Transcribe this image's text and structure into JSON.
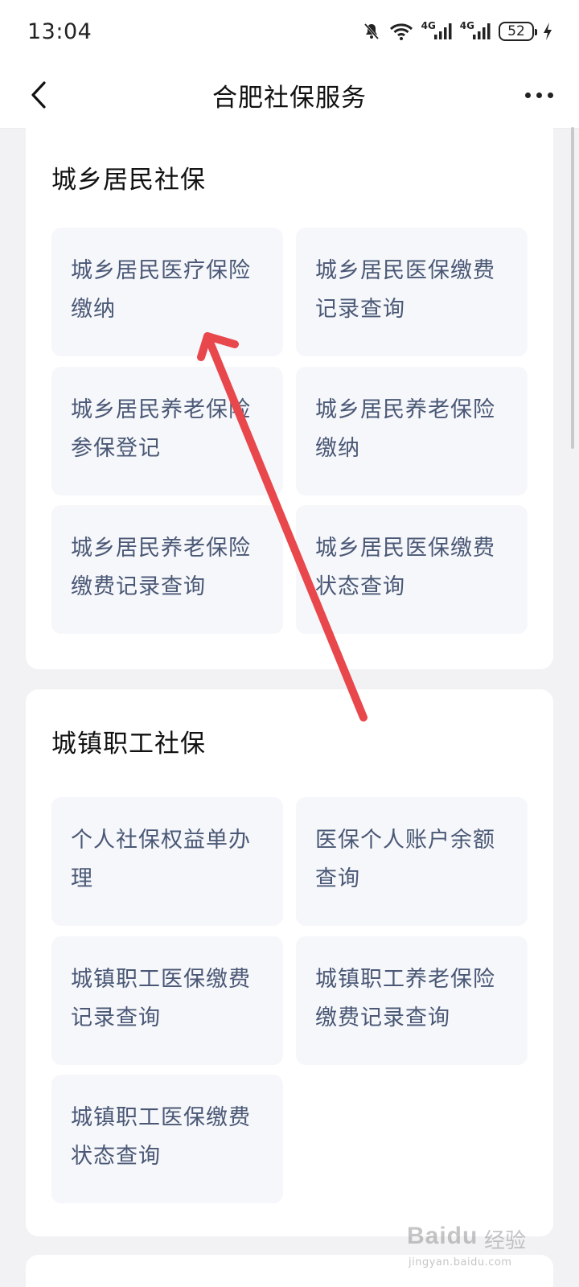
{
  "status_bar": {
    "time": "13:04",
    "network_1": "4G",
    "network_2": "4G",
    "battery": "52",
    "icons": [
      "mute-bell-icon",
      "wifi-icon",
      "signal-icon",
      "signal-icon",
      "battery-icon",
      "charging-icon"
    ]
  },
  "nav": {
    "back_icon": "chevron-left-icon",
    "title": "合肥社保服务",
    "more_icon": "more-dots-icon"
  },
  "sections": [
    {
      "title": "城乡居民社保",
      "items": [
        {
          "line1": "城乡居民医疗保险",
          "line2": "缴纳"
        },
        {
          "line1": "城乡居民医保缴费",
          "line2": "记录查询"
        },
        {
          "line1": "城乡居民养老保险",
          "line2": "参保登记"
        },
        {
          "line1": "城乡居民养老保险",
          "line2": "缴纳"
        },
        {
          "line1": "城乡居民养老保险",
          "line2": "缴费记录查询"
        },
        {
          "line1": "城乡居民医保缴费",
          "line2": "状态查询"
        }
      ]
    },
    {
      "title": "城镇职工社保",
      "items": [
        {
          "line1": "个人社保权益单办",
          "line2": "理"
        },
        {
          "line1": "医保个人账户余额",
          "line2": "查询"
        },
        {
          "line1": "城镇职工医保缴费",
          "line2": "记录查询"
        },
        {
          "line1": "城镇职工养老保险",
          "line2": "缴费记录查询"
        },
        {
          "line1": "城镇职工医保缴费",
          "line2": "状态查询"
        }
      ]
    }
  ],
  "annotation": {
    "color": "#e8474c"
  },
  "watermark": {
    "brand": "Baidu",
    "suffix": "经验",
    "url": "jingyan.baidu.com"
  },
  "colors": {
    "background": "#f2f2f4",
    "card": "#ffffff",
    "tile": "#f6f7fa",
    "tile_text": "#4a5876"
  }
}
